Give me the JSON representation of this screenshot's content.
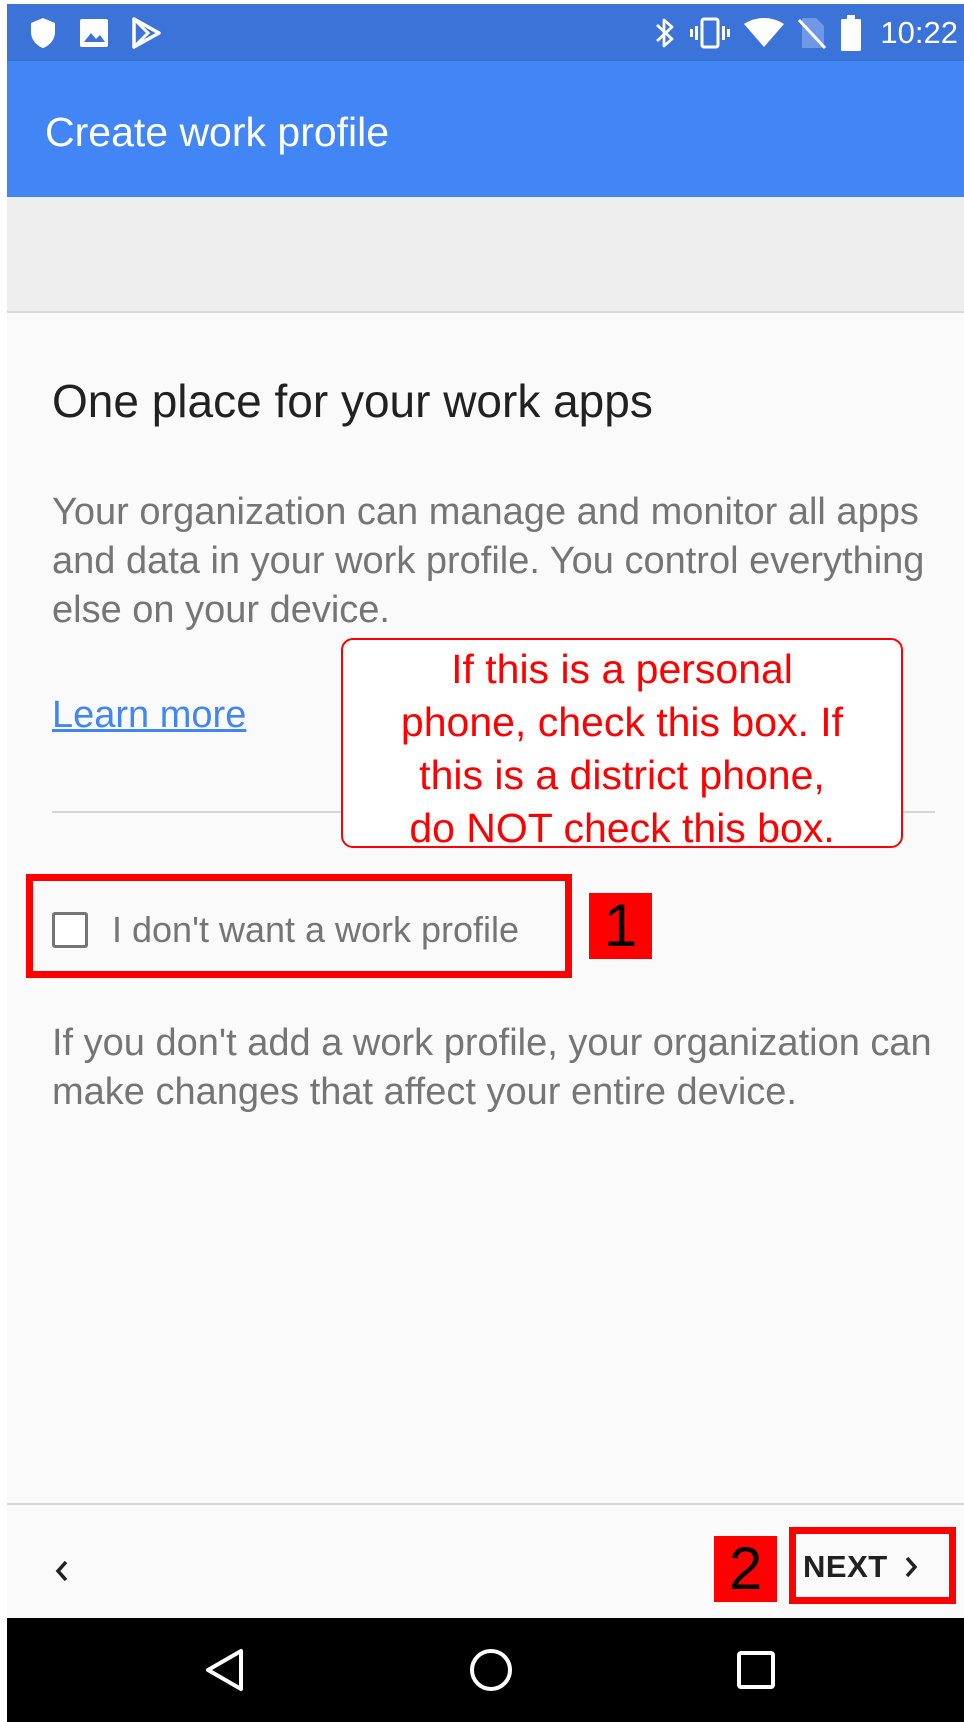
{
  "status_bar": {
    "time": "10:22",
    "left_icons": [
      "shield-icon",
      "image-icon",
      "play-store-icon"
    ],
    "right_icons": [
      "bluetooth-icon",
      "vibrate-icon",
      "wifi-icon",
      "no-sim-icon",
      "battery-icon"
    ]
  },
  "app_bar": {
    "title": "Create work profile"
  },
  "content": {
    "heading": "One place for your work apps",
    "description": "Your organization can manage and monitor all apps and data in your work profile. You control everything else on your device.",
    "learn_more": "Learn more",
    "checkbox_label": "I don't want a work profile",
    "checkbox_checked": false,
    "note": "If you don't add a work profile, your organization can make changes that affect your entire device."
  },
  "annotation": {
    "callout_lines": [
      "If this is a personal",
      "phone, check this box. If",
      "this is a district phone,",
      "do NOT check this box."
    ],
    "step1": "1",
    "step2": "2",
    "highlight_color": "#ff0000"
  },
  "footer": {
    "next_label": "NEXT"
  },
  "colors": {
    "status_bar": "#3b73d9",
    "app_bar": "#4285f4",
    "link": "#4285f4"
  },
  "nav_bar": {
    "buttons": [
      "back-triangle-icon",
      "home-circle-icon",
      "recents-square-icon"
    ]
  }
}
